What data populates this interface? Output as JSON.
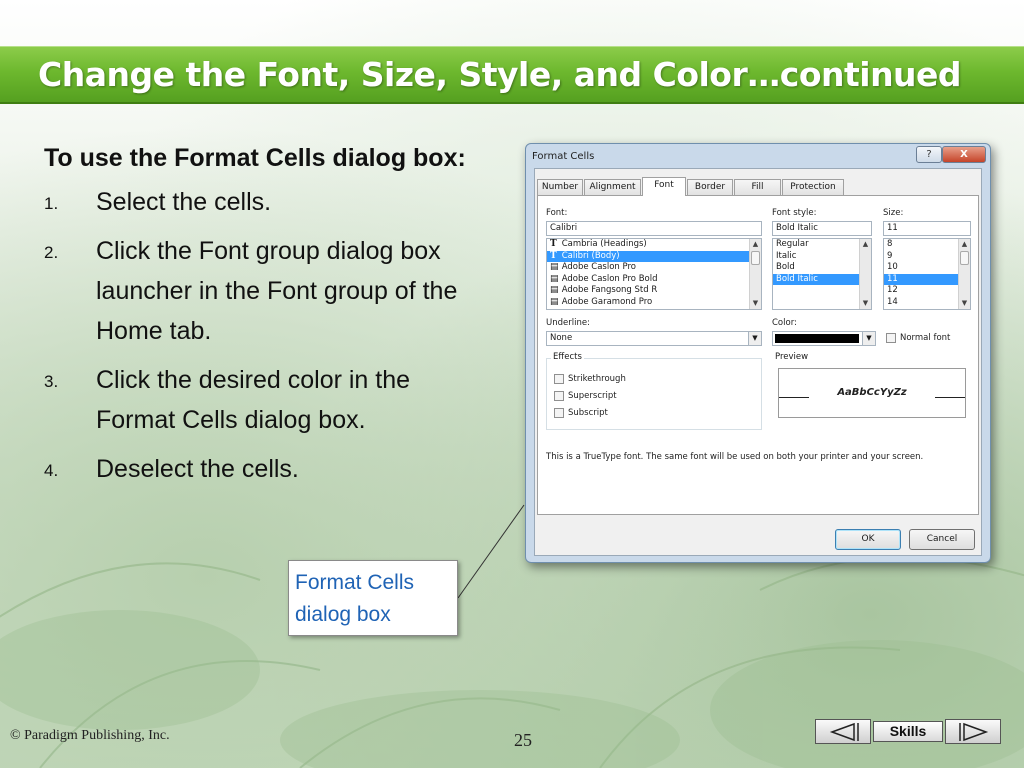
{
  "slide": {
    "title": "Change the Font, Size, Style, and Color…continued",
    "intro": "To use the Format Cells dialog box:",
    "steps": [
      {
        "num": "1.",
        "text": "Select the cells."
      },
      {
        "num": "2.",
        "text": "Click the Font group dialog box launcher in the Font group of the Home tab."
      },
      {
        "num": "3.",
        "text": "Click the desired color in the Format Cells dialog box."
      },
      {
        "num": "4.",
        "text": "Deselect the cells."
      }
    ],
    "callout": "Format Cells dialog box",
    "colors": {
      "title_bar": "#6db82e",
      "callout_text": "#1f63b5"
    }
  },
  "dialog": {
    "title": "Format Cells",
    "help_label": "?",
    "close_label": "X",
    "tabs": [
      "Number",
      "Alignment",
      "Font",
      "Border",
      "Fill",
      "Protection"
    ],
    "active_tab": "Font",
    "font_label": "Font:",
    "font_value": "Calibri",
    "font_list": [
      "Cambria (Headings)",
      "Calibri (Body)",
      "Adobe Caslon Pro",
      "Adobe Caslon Pro Bold",
      "Adobe Fangsong Std R",
      "Adobe Garamond Pro"
    ],
    "font_style_label": "Font style:",
    "font_style_value": "Bold Italic",
    "font_style_list": [
      "Regular",
      "Italic",
      "Bold",
      "Bold Italic"
    ],
    "size_label": "Size:",
    "size_value": "11",
    "size_list": [
      "8",
      "9",
      "10",
      "11",
      "12",
      "14"
    ],
    "underline_label": "Underline:",
    "underline_value": "None",
    "color_label": "Color:",
    "normal_font_label": "Normal font",
    "effects_label": "Effects",
    "effects": [
      "Strikethrough",
      "Superscript",
      "Subscript"
    ],
    "preview_label": "Preview",
    "preview_text": "AaBbCcYyZz",
    "info_text": "This is a TrueType font.  The same font will be used on both your printer and your screen.",
    "ok_label": "OK",
    "cancel_label": "Cancel"
  },
  "footer": {
    "copyright": "© Paradigm Publishing, Inc.",
    "page_number": "25",
    "skills_label": "Skills"
  }
}
